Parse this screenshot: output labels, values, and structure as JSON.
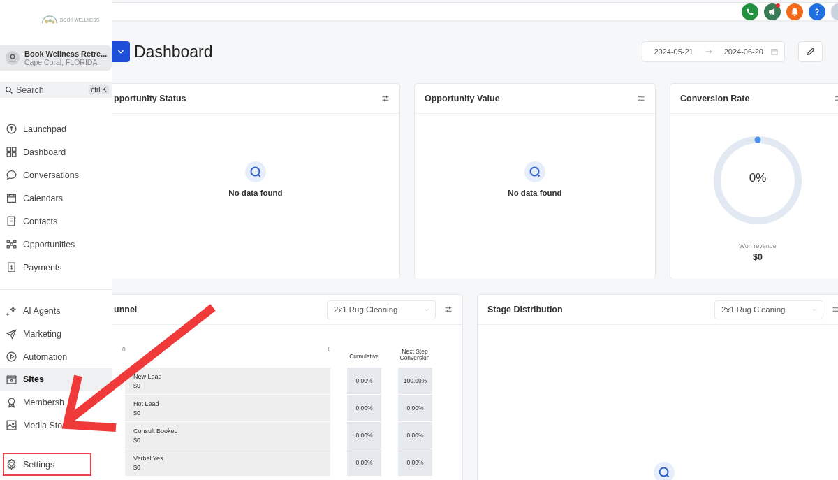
{
  "sidebar": {
    "logo_text": "BOOK WELLNESS",
    "account": {
      "name": "Book Wellness Retre...",
      "location": "Cape Coral, FLORIDA"
    },
    "search": {
      "placeholder": "Search",
      "shortcut": "ctrl K"
    },
    "groups": [
      {
        "items": [
          {
            "label": "Launchpad",
            "selected": false,
            "highlighted": false
          },
          {
            "label": "Dashboard",
            "selected": false,
            "highlighted": false
          },
          {
            "label": "Conversations",
            "selected": false,
            "highlighted": false
          },
          {
            "label": "Calendars",
            "selected": false,
            "highlighted": false
          },
          {
            "label": "Contacts",
            "selected": false,
            "highlighted": false
          },
          {
            "label": "Opportunities",
            "selected": false,
            "highlighted": false
          },
          {
            "label": "Payments",
            "selected": false,
            "highlighted": false
          }
        ]
      },
      {
        "items": [
          {
            "label": "AI Agents",
            "selected": false,
            "highlighted": false
          },
          {
            "label": "Marketing",
            "selected": false,
            "highlighted": false
          },
          {
            "label": "Automation",
            "selected": false,
            "highlighted": false
          },
          {
            "label": "Sites",
            "selected": true,
            "highlighted": false
          },
          {
            "label": "Membersh",
            "selected": false,
            "highlighted": false
          },
          {
            "label": "Media Sto",
            "selected": false,
            "highlighted": false
          }
        ]
      },
      {
        "items": [
          {
            "label": "Settings",
            "selected": false,
            "highlighted": true
          }
        ]
      }
    ]
  },
  "annotation": {
    "kind": "arrow"
  },
  "header": {
    "title": "Dashboard",
    "date_from": "2024-05-21",
    "date_to": "2024-06-20"
  },
  "cards": [
    {
      "kind": "empty",
      "title": "pportunity Status",
      "empty_text": "No data found"
    },
    {
      "kind": "empty",
      "title": "Opportunity Value",
      "empty_text": "No data found"
    },
    {
      "kind": "donut",
      "title": "Conversion Rate",
      "value": "0%",
      "caption": "Won revenue",
      "amount": "$0"
    }
  ],
  "funnel": {
    "title": "unnel",
    "pipeline": "2x1 Rug Cleaning",
    "axis_start": "0",
    "axis_end": "1",
    "col_cumulative": "Cumulative",
    "col_next": "Next Step Conversion",
    "rows": [
      {
        "name": "New Lead",
        "value": "$0",
        "cumulative": "0.00%",
        "next": "100.00%"
      },
      {
        "name": "Hot Lead",
        "value": "$0",
        "cumulative": "0.00%",
        "next": "0.00%"
      },
      {
        "name": "Consult Booked",
        "value": "$0",
        "cumulative": "0.00%",
        "next": "0.00%"
      },
      {
        "name": "Verbal Yes",
        "value": "$0",
        "cumulative": "0.00%",
        "next": "0.00%"
      }
    ]
  },
  "stage": {
    "title": "Stage Distribution",
    "pipeline": "2x1 Rug Cleaning"
  }
}
